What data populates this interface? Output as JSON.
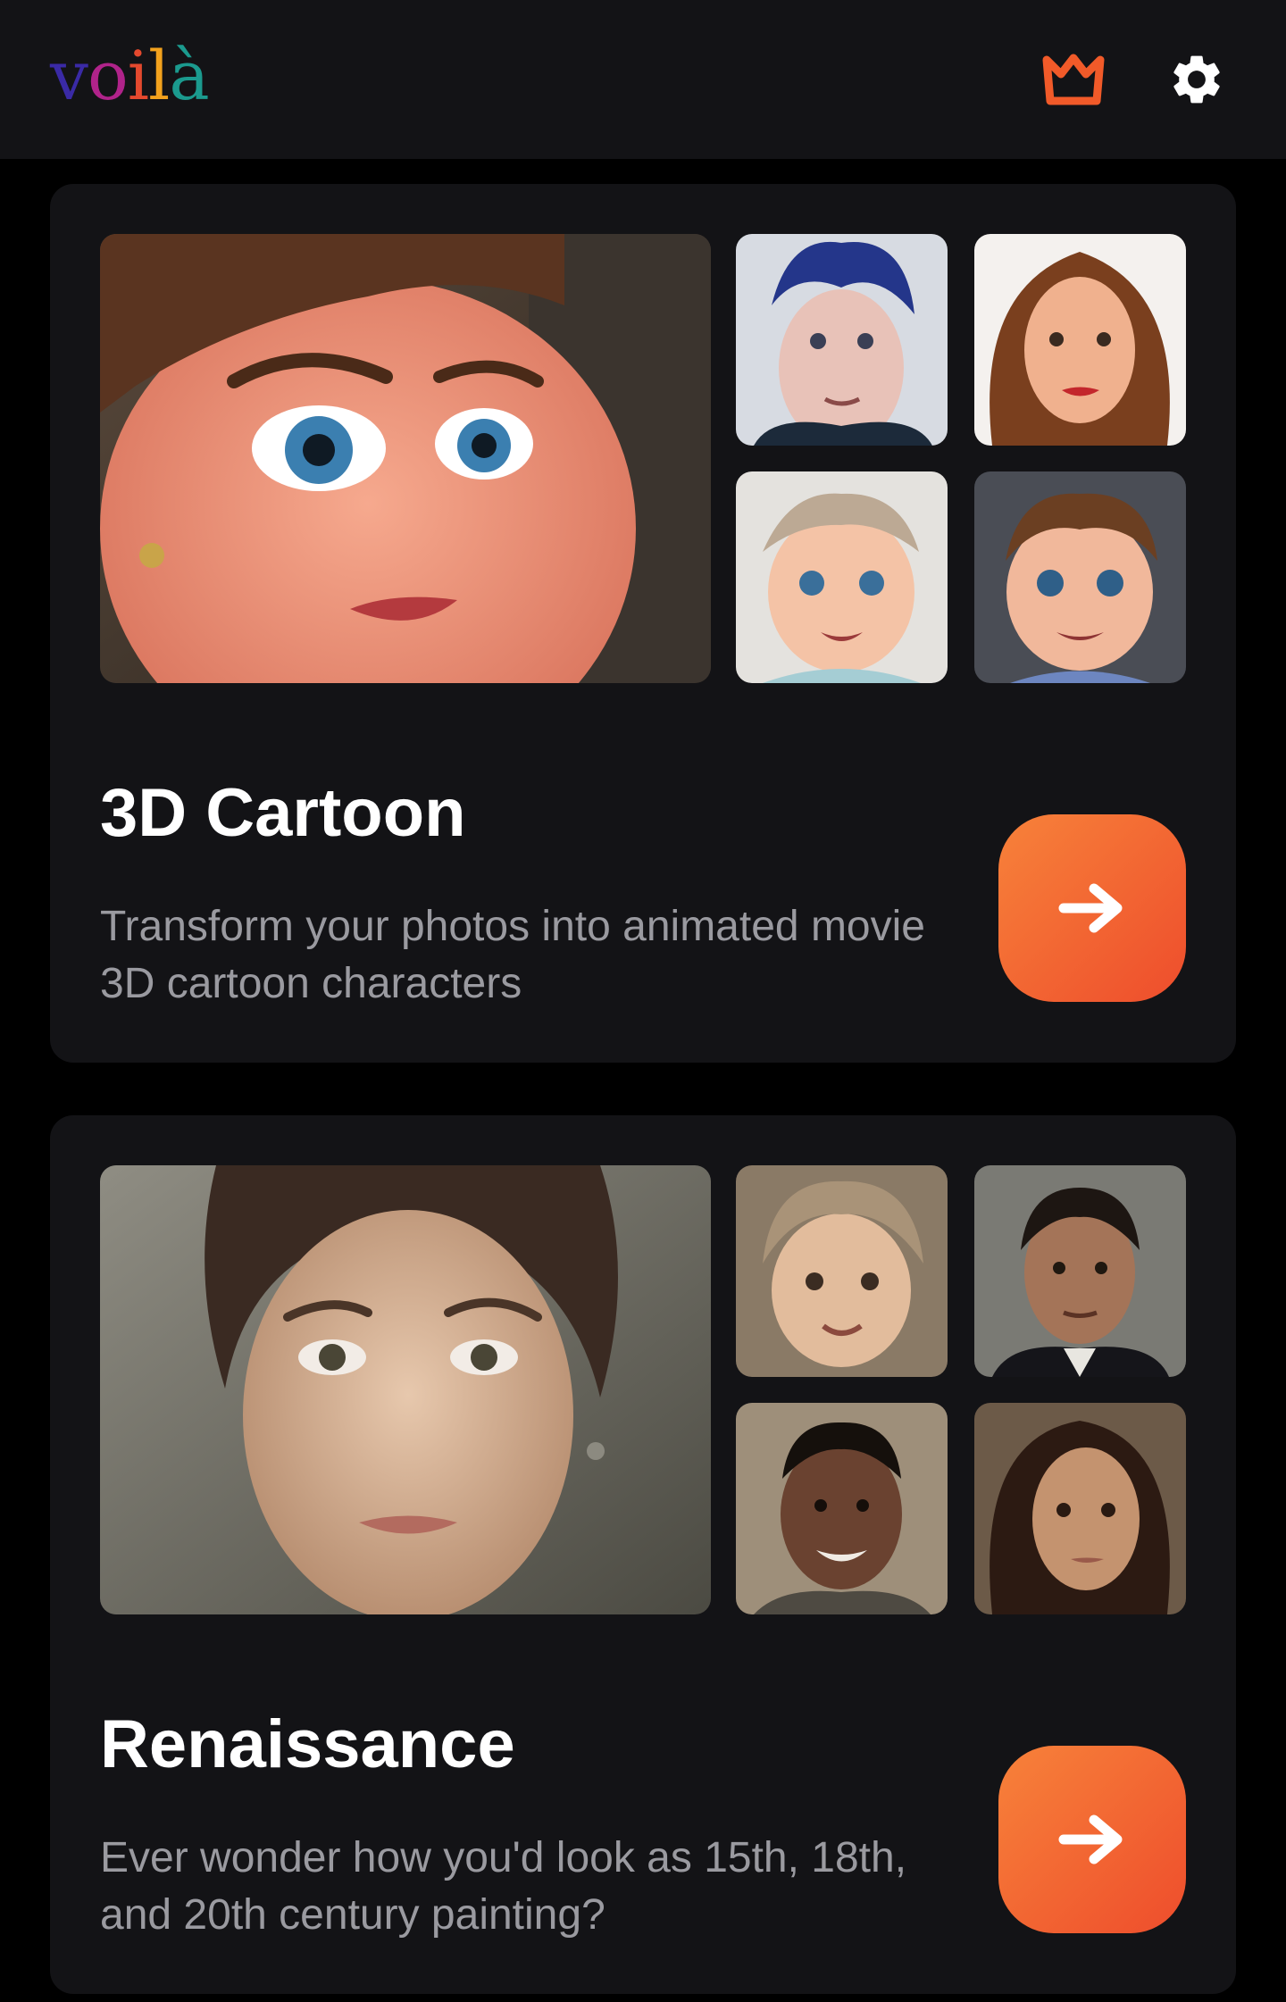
{
  "header": {
    "logo_letters": [
      {
        "char": "v",
        "color": "#3a2aa6"
      },
      {
        "char": "o",
        "color": "#b0238a"
      },
      {
        "char": "i",
        "color": "#e4492e"
      },
      {
        "char": "l",
        "color": "#f2a11d"
      },
      {
        "char": "à",
        "color": "#1b9a8e"
      }
    ],
    "premium_icon": "crown-icon",
    "settings_icon": "gear-icon",
    "accent_color": "#f15a29"
  },
  "cards": [
    {
      "title": "3D Cartoon",
      "description": "Transform your photos into animated movie 3D cartoon characters",
      "action_icon": "arrow-right-icon"
    },
    {
      "title": "Renaissance",
      "description": "Ever wonder how you'd look as 15th, 18th, and 20th century painting?",
      "action_icon": "arrow-right-icon"
    }
  ]
}
